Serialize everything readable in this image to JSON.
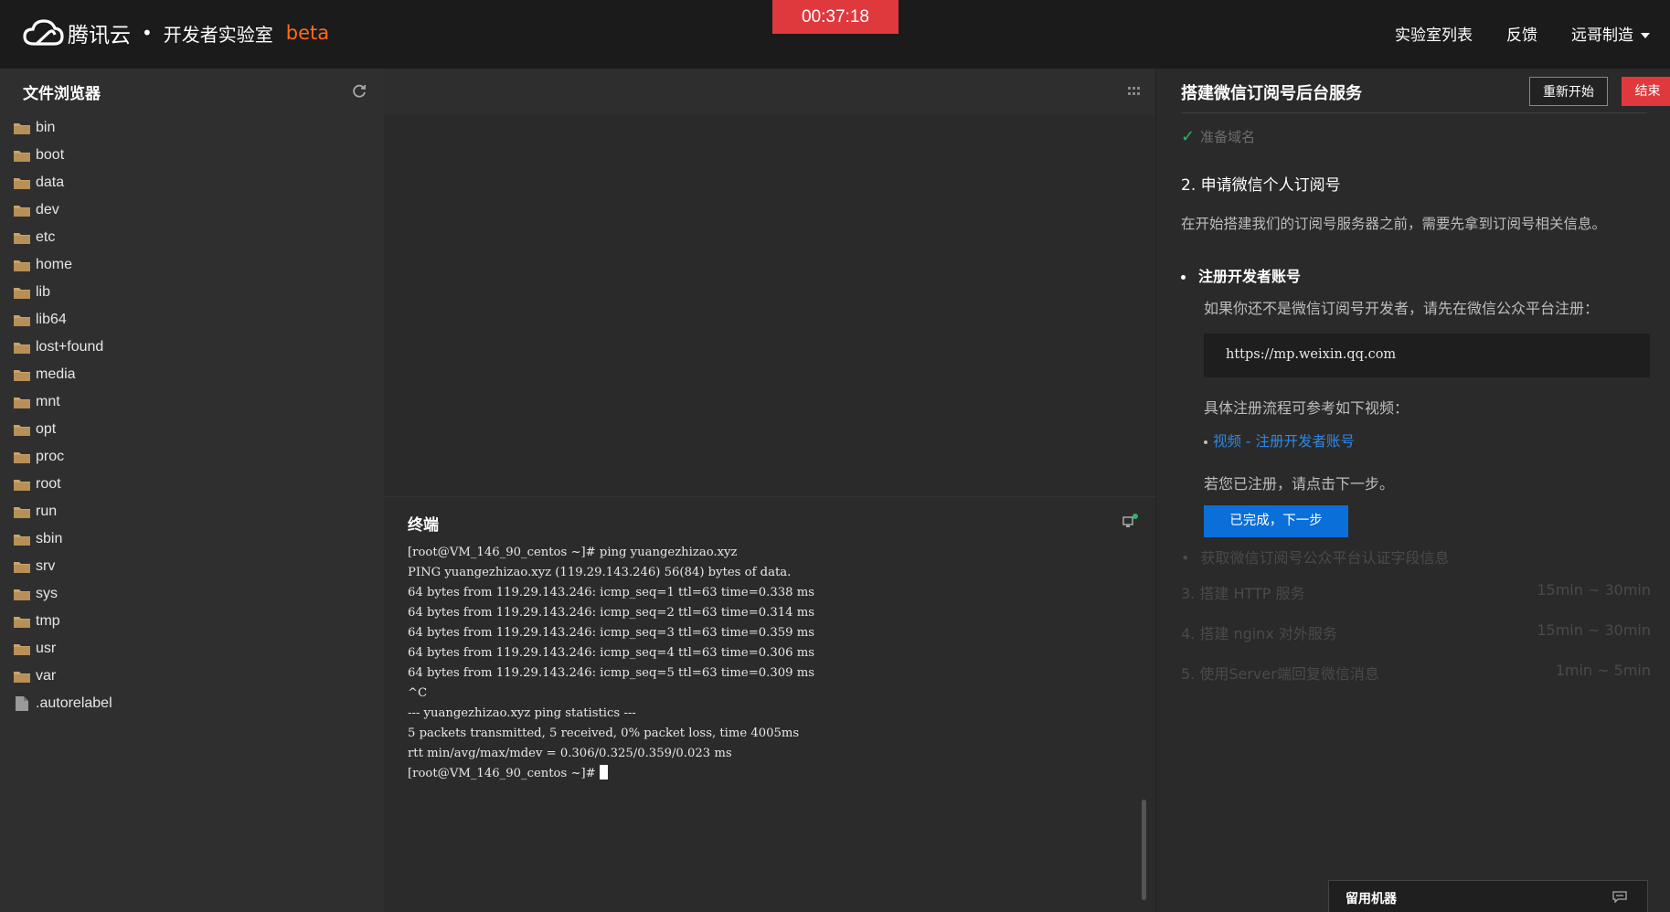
{
  "header": {
    "brand": "腾讯云",
    "dot": "•",
    "product": "开发者实验室",
    "beta": "beta",
    "timer": "00:37:18",
    "nav": [
      "实验室列表",
      "反馈",
      "远哥制造"
    ]
  },
  "file_browser": {
    "title": "文件浏览器",
    "items": [
      {
        "name": "bin",
        "type": "folder"
      },
      {
        "name": "boot",
        "type": "folder"
      },
      {
        "name": "data",
        "type": "folder"
      },
      {
        "name": "dev",
        "type": "folder"
      },
      {
        "name": "etc",
        "type": "folder"
      },
      {
        "name": "home",
        "type": "folder"
      },
      {
        "name": "lib",
        "type": "folder"
      },
      {
        "name": "lib64",
        "type": "folder"
      },
      {
        "name": "lost+found",
        "type": "folder"
      },
      {
        "name": "media",
        "type": "folder"
      },
      {
        "name": "mnt",
        "type": "folder"
      },
      {
        "name": "opt",
        "type": "folder"
      },
      {
        "name": "proc",
        "type": "folder"
      },
      {
        "name": "root",
        "type": "folder"
      },
      {
        "name": "run",
        "type": "folder"
      },
      {
        "name": "sbin",
        "type": "folder"
      },
      {
        "name": "srv",
        "type": "folder"
      },
      {
        "name": "sys",
        "type": "folder"
      },
      {
        "name": "tmp",
        "type": "folder"
      },
      {
        "name": "usr",
        "type": "folder"
      },
      {
        "name": "var",
        "type": "folder"
      },
      {
        "name": ".autorelabel",
        "type": "file"
      }
    ]
  },
  "terminal": {
    "title": "终端",
    "lines": [
      "[root@VM_146_90_centos ~]# ping yuangezhizao.xyz",
      "PING yuangezhizao.xyz (119.29.143.246) 56(84) bytes of data.",
      "64 bytes from 119.29.143.246: icmp_seq=1 ttl=63 time=0.338 ms",
      "64 bytes from 119.29.143.246: icmp_seq=2 ttl=63 time=0.314 ms",
      "64 bytes from 119.29.143.246: icmp_seq=3 ttl=63 time=0.359 ms",
      "64 bytes from 119.29.143.246: icmp_seq=4 ttl=63 time=0.306 ms",
      "64 bytes from 119.29.143.246: icmp_seq=5 ttl=63 time=0.309 ms",
      "^C",
      "--- yuangezhizao.xyz ping statistics ---",
      "5 packets transmitted, 5 received, 0% packet loss, time 4005ms",
      "rtt min/avg/max/mdev = 0.306/0.325/0.359/0.023 ms"
    ],
    "prompt": "[root@VM_146_90_centos ~]# "
  },
  "guide": {
    "title": "搭建微信订阅号后台服务",
    "restart_label": "重新开始",
    "end_label": "结束",
    "done_step": "准备域名",
    "step2_title": "2. 申请微信个人订阅号",
    "step2_desc": "在开始搭建我们的订阅号服务器之前，需要先拿到订阅号相关信息。",
    "sub_title": "注册开发者账号",
    "sub_text1": "如果你还不是微信订阅号开发者，请先在微信公众平台注册：",
    "code": "https://mp.weixin.qq.com",
    "sub_text2": "具体注册流程可参考如下视频：",
    "video_link": "视频 - 注册开发者账号",
    "sub_text3": "若您已注册，请点击下一步。",
    "next_label": "已完成，下一步",
    "upcoming_sub": "获取微信订阅号公众平台认证字段信息",
    "upcoming_steps": [
      {
        "title": "3. 搭建 HTTP 服务",
        "time": "15min ~ 30min"
      },
      {
        "title": "4. 搭建 nginx 对外服务",
        "time": "15min ~ 30min"
      },
      {
        "title": "5. 使用Server端回复微信消息",
        "time": "1min ~ 5min"
      }
    ],
    "keep_machine": "留用机器"
  },
  "colors": {
    "accent_red": "#e0393d",
    "accent_orange": "#ff6a1f",
    "link_blue": "#2e88e5",
    "button_blue": "#0a6fd9",
    "check_green": "#2fb36b"
  }
}
